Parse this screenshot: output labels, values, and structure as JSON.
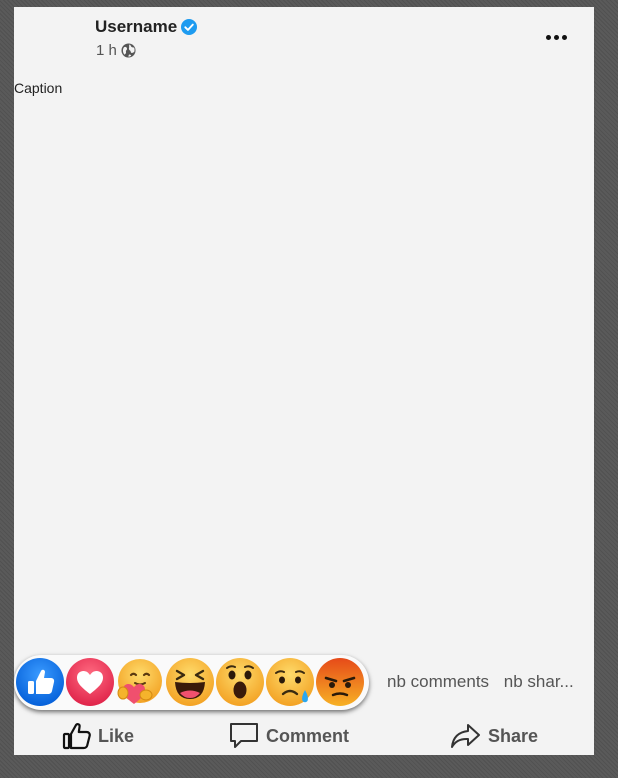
{
  "post": {
    "username": "Username",
    "time": "1 h",
    "caption": "Caption",
    "verified": true,
    "audience_icon": "globe-icon",
    "menu_icon": "more-horizontal-icon"
  },
  "reactions": [
    {
      "name": "like",
      "icon": "thumbs-up-icon",
      "color": "#1877f2"
    },
    {
      "name": "love",
      "icon": "heart-icon",
      "color": "#f0506e"
    },
    {
      "name": "care",
      "icon": "care-icon",
      "color": "#f7b125"
    },
    {
      "name": "haha",
      "icon": "laughing-face-icon",
      "color": "#f7b125"
    },
    {
      "name": "wow",
      "icon": "surprised-face-icon",
      "color": "#f7b125"
    },
    {
      "name": "sad",
      "icon": "crying-face-icon",
      "color": "#f7b125"
    },
    {
      "name": "angry",
      "icon": "angry-face-icon",
      "color": "#e9710f"
    }
  ],
  "stats": {
    "comments": "nb comments",
    "shares": "nb shar..."
  },
  "actions": {
    "like": "Like",
    "comment": "Comment",
    "share": "Share"
  },
  "colors": {
    "background": "#5a5a5a",
    "card": "#f3f3f3",
    "verified": "#1d9bf0",
    "text_muted": "#555555"
  }
}
